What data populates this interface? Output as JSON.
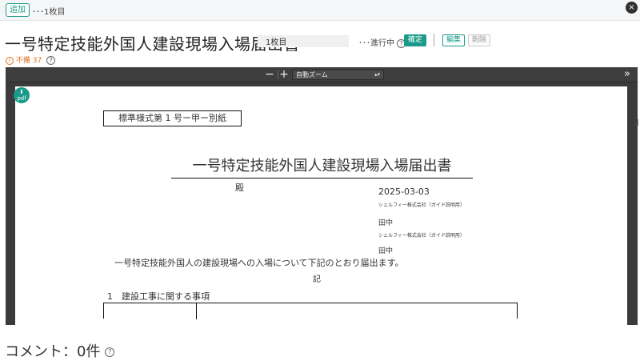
{
  "topbar": {
    "add_label": "追加",
    "tab_label": "･･･1枚目",
    "close_symbol": "×"
  },
  "header": {
    "title": "一号特定技能外国人建設現場入場届出書",
    "sheet_value": "1枚目",
    "status_text": "･･･進行中",
    "confirm_label": "確定",
    "edit_label": "編集",
    "delete_label": "削除"
  },
  "warning": {
    "text": "不備 37"
  },
  "viewer": {
    "minus": "−",
    "plus": "+",
    "zoom_value": "自動ズーム",
    "sidebar_toggle": "»",
    "pdf_badge": "pdf"
  },
  "document": {
    "form_label": "標準様式第 1 号ー甲ー別紙",
    "title": "一号特定技能外国人建設現場入場届出書",
    "addressee": "殿",
    "date": "2025-03-03",
    "company1": "シェルフィー株式会社（ガイド説明用）",
    "name1": "田中",
    "company2": "シェルフィー株式会社（ガイド説明用）",
    "name2": "田中",
    "body": "一号特定技能外国人の建設現場への入場について下記のとおり届出ます。",
    "ki": "記",
    "section1": "1　建設工事に関する事項"
  },
  "comments": {
    "label": "コメント：0件"
  },
  "colors": {
    "accent": "#1a9a8a",
    "warning": "#e07020",
    "viewer_bg": "#3b3b3b"
  }
}
